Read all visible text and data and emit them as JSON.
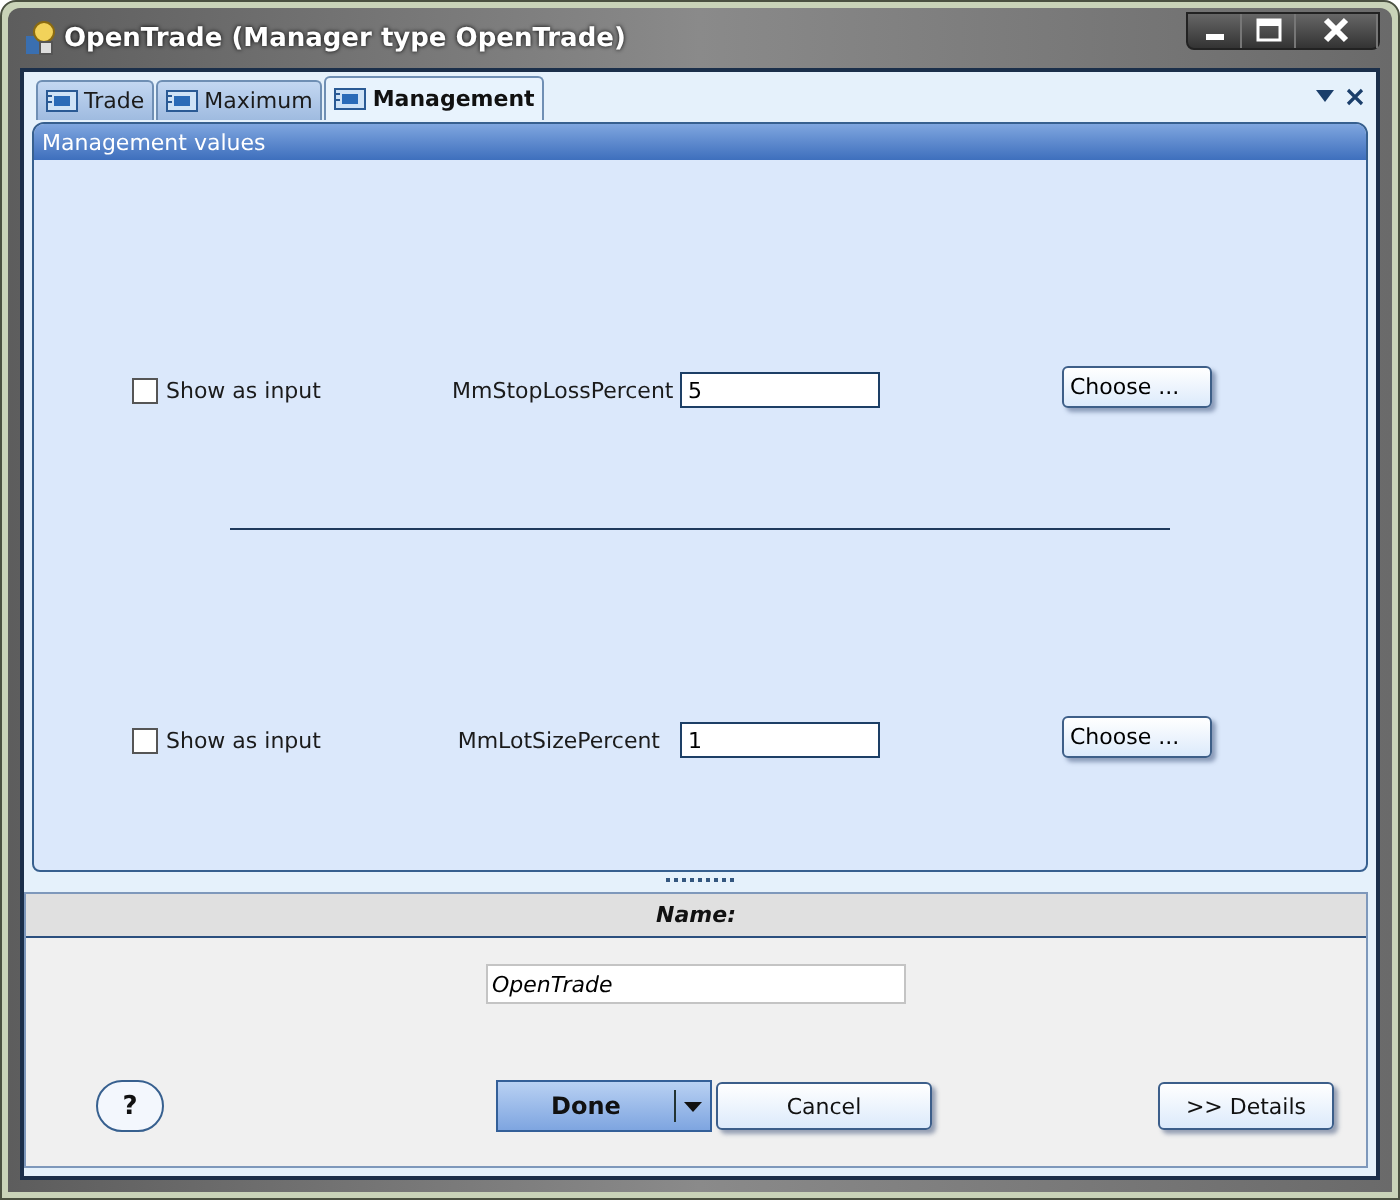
{
  "window": {
    "title": "OpenTrade (Manager type OpenTrade)"
  },
  "tabs": [
    {
      "label": "Trade",
      "selected": false
    },
    {
      "label": "Maximum",
      "selected": false
    },
    {
      "label": "Management",
      "selected": true
    }
  ],
  "panel": {
    "title": "Management values"
  },
  "parameters": [
    {
      "show_as_input_label": "Show as input",
      "checked": false,
      "name": "MmStopLossPercent",
      "value": "5",
      "choose_button": "Choose ..."
    },
    {
      "show_as_input_label": "Show as input",
      "checked": false,
      "name": "MmLotSizePercent",
      "value": "1",
      "choose_button": "Choose ..."
    }
  ],
  "name_section": {
    "header": "Name:",
    "value": "OpenTrade"
  },
  "buttons": {
    "help": "?",
    "done": "Done",
    "cancel": "Cancel",
    "details": ">> Details"
  }
}
